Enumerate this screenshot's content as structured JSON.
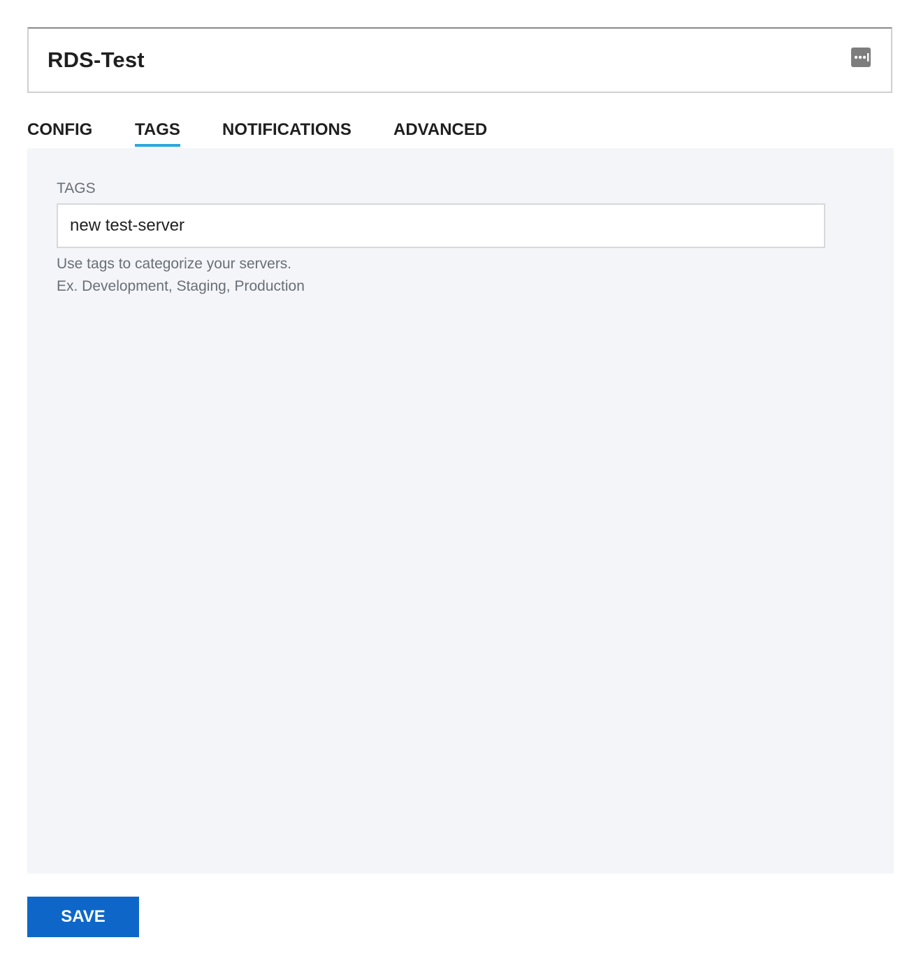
{
  "header": {
    "title": "RDS-Test",
    "menu_icon": "more-options-icon"
  },
  "tabs": [
    {
      "label": "CONFIG",
      "active": false
    },
    {
      "label": "TAGS",
      "active": true
    },
    {
      "label": "NOTIFICATIONS",
      "active": false
    },
    {
      "label": "ADVANCED",
      "active": false
    }
  ],
  "tags_panel": {
    "label": "TAGS",
    "input_value": "new test-server",
    "help_lines": [
      "Use tags to categorize your servers.",
      "Ex. Development, Staging, Production"
    ]
  },
  "footer": {
    "save_label": "SAVE"
  },
  "colors": {
    "accent_underline": "#2aa7dd",
    "save_button": "#0e67c8",
    "panel_background": "#f3f5f9"
  }
}
